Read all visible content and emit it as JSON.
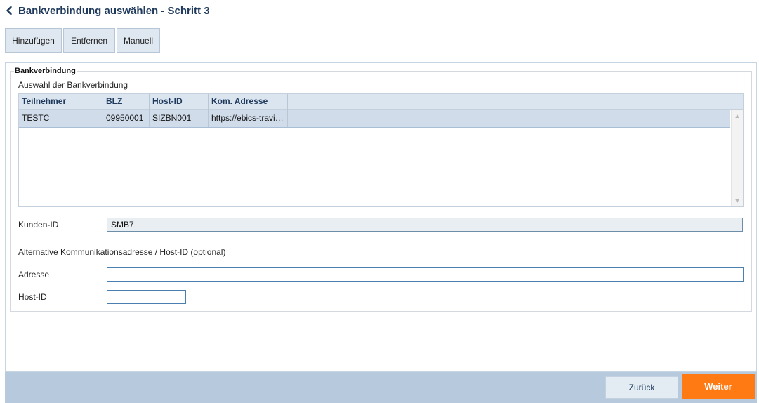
{
  "header": {
    "title": "Bankverbindung auswählen - Schritt 3",
    "back_icon": "chevron-left-icon"
  },
  "toolbar": {
    "add_label": "Hinzufügen",
    "remove_label": "Entfernen",
    "manual_label": "Manuell"
  },
  "bank_section": {
    "legend": "Bankverbindung",
    "subtitle": "Auswahl der Bankverbindung",
    "columns": [
      "Teilnehmer",
      "BLZ",
      "Host-ID",
      "Kom. Adresse"
    ],
    "rows": [
      {
        "teilnehmer": "TESTC",
        "blz": "09950001",
        "host_id": "SIZBN001",
        "kom_adresse": "https://ebics-travi…"
      }
    ]
  },
  "form": {
    "kunden_id_label": "Kunden-ID",
    "kunden_id_value": "SMB7",
    "alt_heading": "Alternative Kommunikationsadresse / Host-ID (optional)",
    "adresse_label": "Adresse",
    "adresse_value": "",
    "host_id_label": "Host-ID",
    "host_id_value": ""
  },
  "footer": {
    "back_label": "Zurück",
    "next_label": "Weiter"
  },
  "colors": {
    "accent": "#ff7a12",
    "title": "#1f3a5c",
    "footer_bar": "#b7c9dd",
    "selected_row": "#d0dcea"
  }
}
